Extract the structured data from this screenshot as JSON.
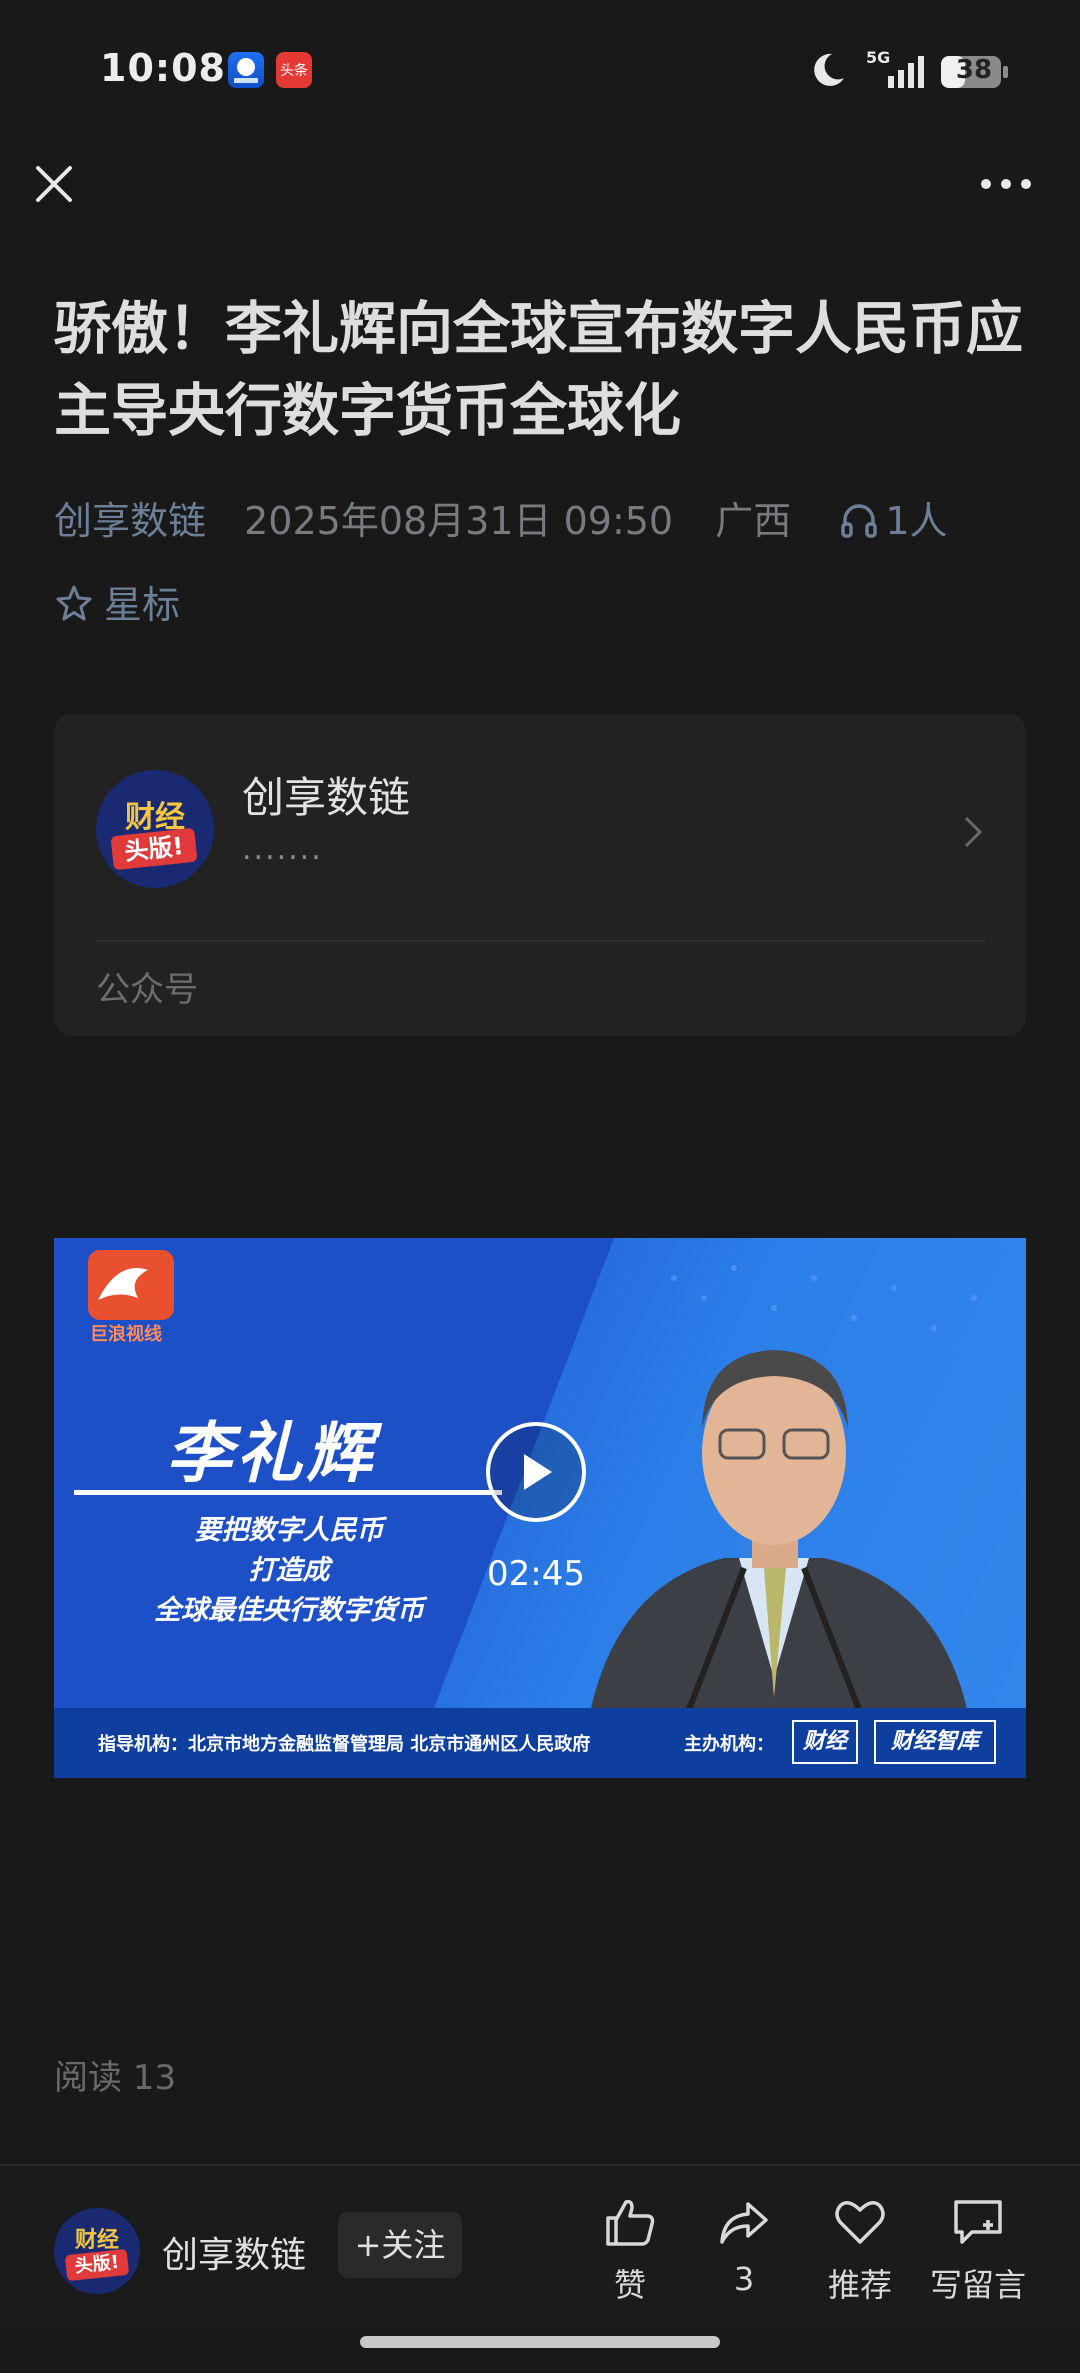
{
  "status_bar": {
    "time": "10:08",
    "app_badges": [
      "App1",
      "头条"
    ],
    "network": "5G",
    "battery": "38"
  },
  "nav": {
    "close_icon": "close-icon",
    "more_icon": "more-icon"
  },
  "article": {
    "title": "骄傲！李礼辉向全球宣布数字人民币应主导央行数字货币全球化",
    "author": "创享数链",
    "date": "2025年08月31日 09:50",
    "region": "广西",
    "listeners": "1人",
    "star_label": "星标"
  },
  "account_card": {
    "avatar_text_top": "财经",
    "avatar_text_bottom": "头版!",
    "name": "创享数链",
    "description": ".......",
    "type_label": "公众号"
  },
  "video": {
    "logo_text": "巨浪视线",
    "person_name": "李礼辉",
    "subtitle_lines": [
      "要把数字人民币",
      "打造成",
      "全球最佳央行数字货币"
    ],
    "footer_guidance": "指导机构：北京市地方金融监督管理局   北京市通州区人民政府",
    "footer_host_label": "主办机构：",
    "host_org_1": "财经",
    "host_org_2": "财经智库",
    "duration": "02:45"
  },
  "read_count": "阅读 13",
  "bottom_bar": {
    "avatar_text_top": "财经",
    "avatar_text_bottom": "头版!",
    "name": "创享数链",
    "follow_label": "+关注",
    "like_label": "赞",
    "share_count": "3",
    "recommend_label": "推荐",
    "comment_label": "写留言"
  },
  "colors": {
    "background": "#191919",
    "accent_blue_gray": "#6c7f98",
    "video_blue": "#1c5bd8"
  }
}
